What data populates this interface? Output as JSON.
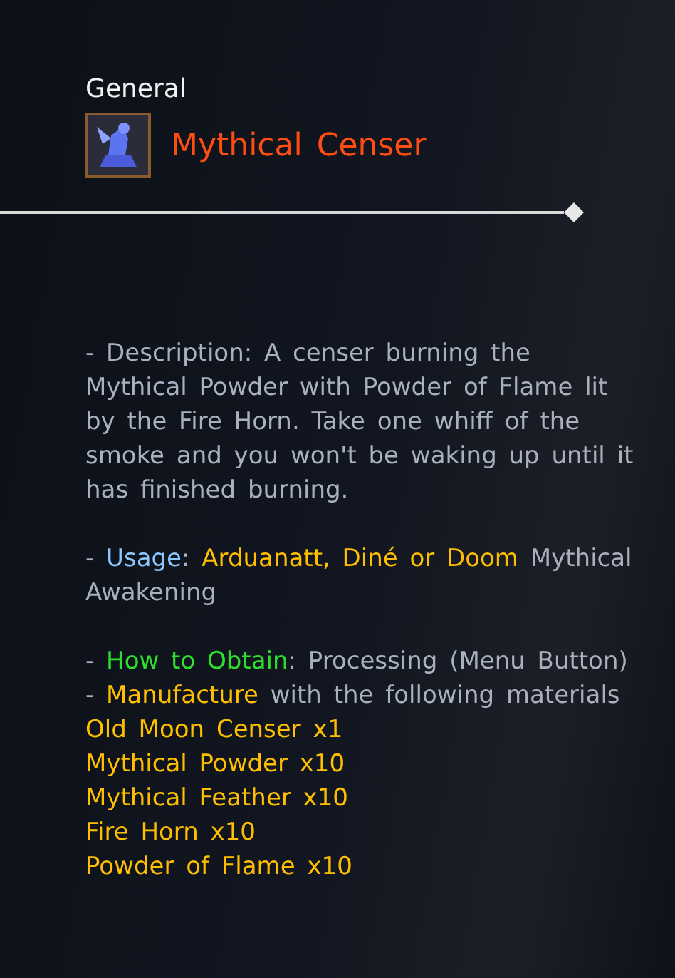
{
  "category": "General",
  "item": {
    "name": "Mythical Censer"
  },
  "paragraphs": [
    {
      "segments": [
        {
          "kind": "plain",
          "text": "- Description: A censer burning the Mythical Powder with Powder of Flame lit by the Fire Horn. Take one whiff of the smoke and you won't be waking up until it has finished burning."
        }
      ]
    },
    {
      "segments": [
        {
          "kind": "plain",
          "text": "- "
        },
        {
          "kind": "usage_label",
          "text": "Usage"
        },
        {
          "kind": "plain",
          "text": ": "
        },
        {
          "kind": "highlight",
          "text": "Arduanatt, Diné or Doom"
        },
        {
          "kind": "plain",
          "text": " Mythical Awakening"
        }
      ]
    },
    {
      "segments": [
        {
          "kind": "plain",
          "text": "- "
        },
        {
          "kind": "obtain_label",
          "text": "How to Obtain"
        },
        {
          "kind": "plain",
          "text": ": Processing (Menu Button) - "
        },
        {
          "kind": "highlight",
          "text": "Manufacture"
        },
        {
          "kind": "plain",
          "text": " with the following materials"
        }
      ]
    }
  ],
  "materials": [
    "Old Moon Censer x1",
    "Mythical Powder x10",
    "Mythical Feather x10",
    "Fire Horn x10",
    "Powder of Flame x10"
  ]
}
